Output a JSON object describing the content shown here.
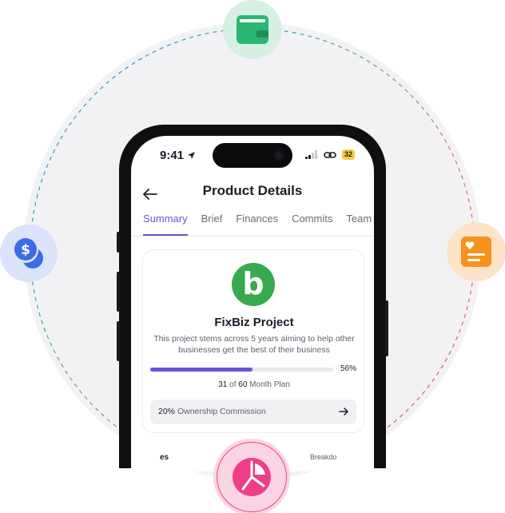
{
  "status_bar": {
    "time": "9:41",
    "battery": "32"
  },
  "header": {
    "title": "Product Details"
  },
  "tabs": [
    {
      "label": "Summary",
      "active": true
    },
    {
      "label": "Brief"
    },
    {
      "label": "Finances"
    },
    {
      "label": "Commits"
    },
    {
      "label": "Team Ma"
    }
  ],
  "project": {
    "name": "FixBiz Project",
    "logo_letter": "b",
    "description": "This project stems across 5 years aiming to help other businesses get the best of their business",
    "progress_percent": 56,
    "progress_label": "56%",
    "plan_done": "31",
    "plan_of": "of",
    "plan_total": "60",
    "plan_unit": "Month Plan",
    "ownership_value": "20%",
    "ownership_label": "Ownership Commission"
  },
  "below": {
    "left": "es",
    "right": "Breakdo"
  },
  "badges": {
    "top": "wallet-icon",
    "left": "dollar-coins-icon",
    "right": "heart-notes-icon",
    "bottom": "pie-chart-icon"
  },
  "colors": {
    "accent": "#6b52d6",
    "logo_green": "#37a94e",
    "wallet_green": "#2bb673",
    "coins_blue": "#3d6be6",
    "notes_orange": "#f6921e",
    "pie_pink": "#ee3f86"
  }
}
